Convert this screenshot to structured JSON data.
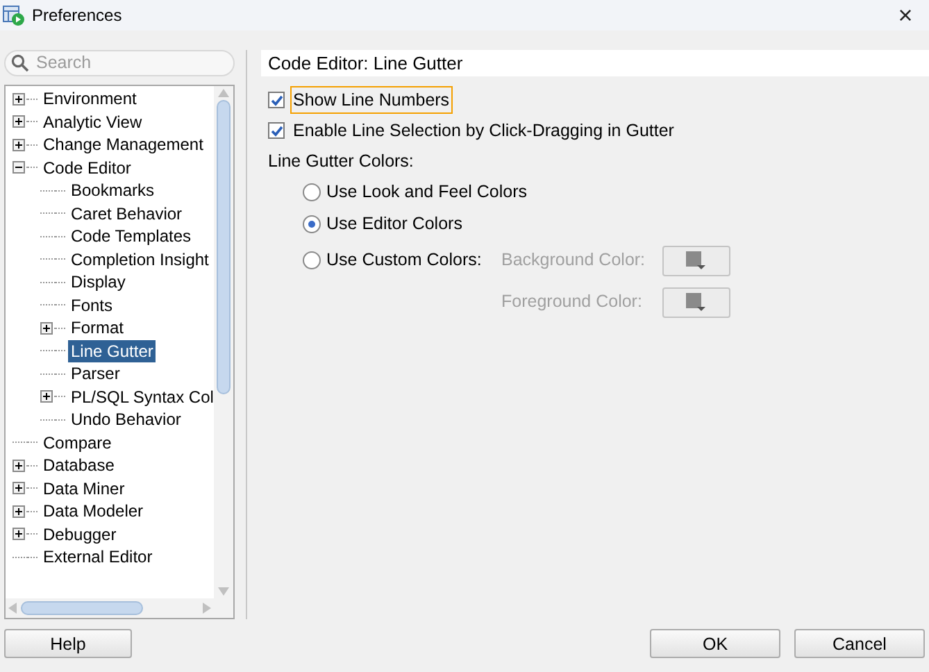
{
  "window": {
    "title": "Preferences",
    "close": "×"
  },
  "search": {
    "placeholder": "Search"
  },
  "tree": [
    {
      "label": "Environment",
      "expanded": false
    },
    {
      "label": "Analytic View",
      "expanded": false
    },
    {
      "label": "Change Management",
      "expanded": false
    },
    {
      "label": "Code Editor",
      "expanded": true,
      "children": [
        {
          "label": "Bookmarks",
          "selected": false
        },
        {
          "label": "Caret Behavior",
          "selected": false
        },
        {
          "label": "Code Templates",
          "selected": false
        },
        {
          "label": "Completion Insight",
          "selected": false
        },
        {
          "label": "Display",
          "selected": false
        },
        {
          "label": "Fonts",
          "selected": false
        },
        {
          "label": "Format",
          "expanded": false,
          "selected": false
        },
        {
          "label": "Line Gutter",
          "selected": true
        },
        {
          "label": "Parser",
          "selected": false
        },
        {
          "label": "PL/SQL Syntax Col",
          "expanded": false,
          "selected": false
        },
        {
          "label": "Undo Behavior",
          "selected": false
        }
      ]
    },
    {
      "label": "Compare"
    },
    {
      "label": "Database",
      "expanded": false
    },
    {
      "label": "Data Miner",
      "expanded": false
    },
    {
      "label": "Data Modeler",
      "expanded": false
    },
    {
      "label": "Debugger",
      "expanded": false
    },
    {
      "label": "External Editor"
    }
  ],
  "panel": {
    "title": "Code Editor: Line Gutter",
    "checkboxes": [
      {
        "label": "Show Line Numbers",
        "checked": true,
        "focused": true
      },
      {
        "label": "Enable Line Selection by Click-Dragging in Gutter",
        "checked": true,
        "focused": false
      }
    ],
    "group_label": "Line Gutter Colors:",
    "radios": [
      {
        "label": "Use Look and Feel Colors",
        "selected": false
      },
      {
        "label": "Use Editor Colors",
        "selected": true
      },
      {
        "label": "Use Custom Colors:",
        "selected": false
      }
    ],
    "color_pickers": [
      {
        "label": "Background Color:",
        "disabled": true
      },
      {
        "label": "Foreground Color:",
        "disabled": true
      }
    ]
  },
  "buttons": [
    {
      "label": "Help",
      "kind": "left"
    },
    {
      "label": "OK",
      "kind": "default"
    },
    {
      "label": "Cancel",
      "kind": "normal"
    }
  ]
}
